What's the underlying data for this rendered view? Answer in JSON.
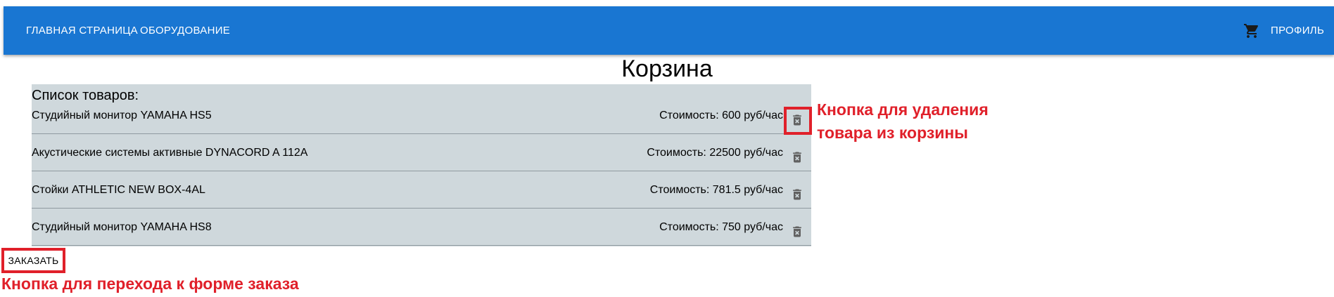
{
  "nav": {
    "home": "ГЛАВНАЯ СТРАНИЦА",
    "equipment": "ОБОРУДОВАНИЕ",
    "profile": "ПРОФИЛЬ",
    "cart_icon": "shopping-cart-icon"
  },
  "page": {
    "title": "Корзина"
  },
  "cart": {
    "heading": "Список товаров:",
    "delete_icon": "delete-forever-icon",
    "items": [
      {
        "name": "Студийный монитор YAMAHA HS5",
        "price": "Стоимость: 600 руб/час"
      },
      {
        "name": "Акустические системы активные DYNACORD A 112A",
        "price": "Стоимость: 22500 руб/час"
      },
      {
        "name": "Стойки ATHLETIC NEW BOX-4AL",
        "price": "Стоимость: 781.5 руб/час"
      },
      {
        "name": "Студийный монитор YAMAHA HS8",
        "price": "Стоимость: 750 руб/час"
      }
    ]
  },
  "order_button": "ЗАКАЗАТЬ",
  "annotations": {
    "delete_line1": "Кнопка для удаления",
    "delete_line2": "товара из корзины",
    "order": "Кнопка для перехода к форме заказа"
  },
  "colors": {
    "appbar": "#1976d2",
    "list_background": "#cfd8dc",
    "annotation": "#e0202a"
  }
}
